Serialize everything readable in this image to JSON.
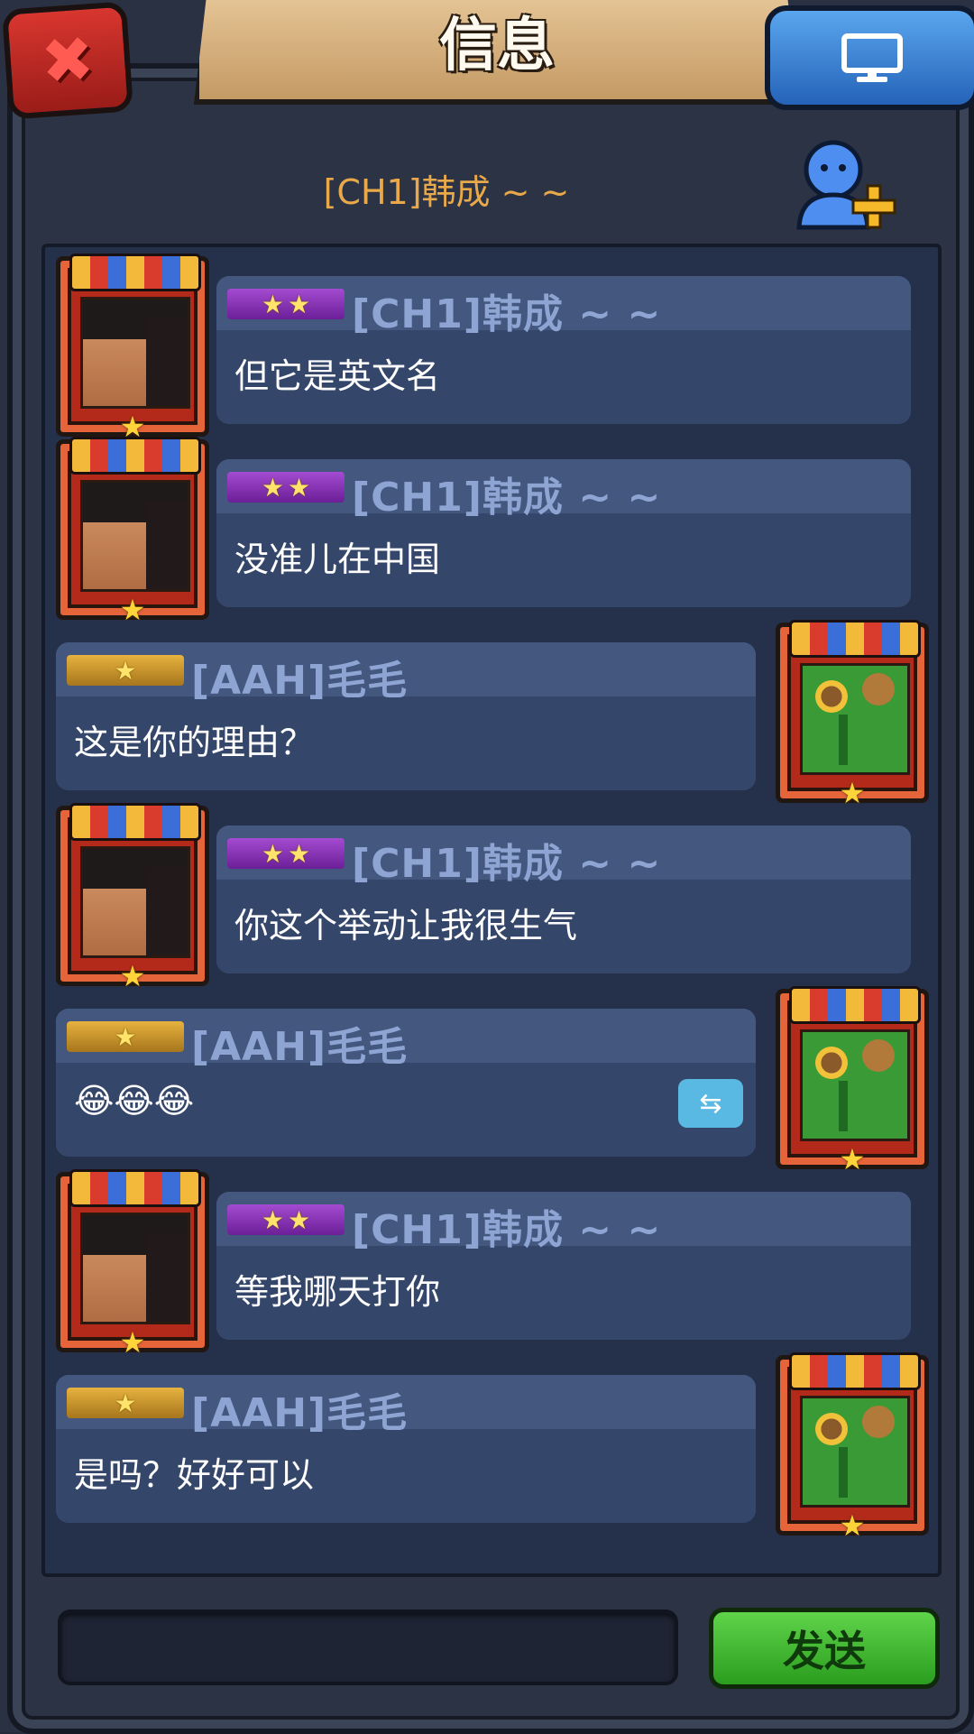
{
  "window": {
    "title": "信息"
  },
  "buttons": {
    "close_icon": "close-icon",
    "monitor_icon": "monitor-icon",
    "add_friend_icon": "add-friend-icon"
  },
  "channel": {
    "name": "[CH1]韩成 ~ ~"
  },
  "messages": [
    {
      "side": "left",
      "sender": "[CH1]韩成 ~ ~",
      "rank_stars": 2,
      "rank_color": "purple",
      "text": "但它是英文名"
    },
    {
      "side": "left",
      "sender": "[CH1]韩成 ~ ~",
      "rank_stars": 2,
      "rank_color": "purple",
      "text": "没准儿在中国"
    },
    {
      "side": "right",
      "sender": "[AAH]毛毛",
      "rank_stars": 1,
      "rank_color": "gold",
      "text": "这是你的理由？"
    },
    {
      "side": "left",
      "sender": "[CH1]韩成 ~ ~",
      "rank_stars": 2,
      "rank_color": "purple",
      "text": "你这个举动让我很生气"
    },
    {
      "side": "right",
      "sender": "[AAH]毛毛",
      "rank_stars": 1,
      "rank_color": "gold",
      "text": "😂😂😂",
      "has_translate": true
    },
    {
      "side": "left",
      "sender": "[CH1]韩成 ~ ~",
      "rank_stars": 2,
      "rank_color": "purple",
      "text": "等我哪天打你"
    },
    {
      "side": "right",
      "sender": "[AAH]毛毛",
      "rank_stars": 1,
      "rank_color": "gold",
      "text": "是吗？好好可以"
    }
  ],
  "input": {
    "value": "",
    "placeholder": ""
  },
  "send": {
    "label": "发送"
  },
  "colors": {
    "sender_name": "#8ea5d3",
    "channel_title": "#e9a94a",
    "send_button": "#3bb52a"
  }
}
